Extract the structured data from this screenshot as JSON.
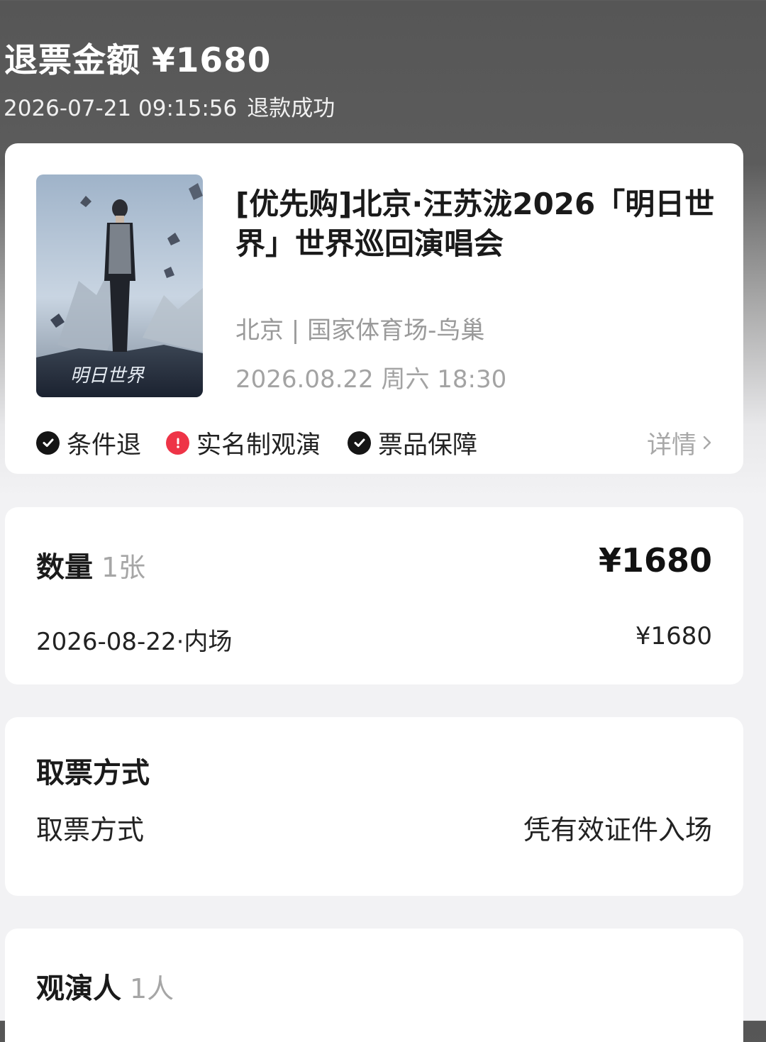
{
  "refund": {
    "label": "退票金额",
    "amount": "¥1680",
    "timestamp": "2026-07-21 09:15:56",
    "status": "退款成功"
  },
  "event": {
    "poster_icon": "concert-poster-image",
    "title": "[优先购]北京·汪苏泷2026「明日世界」世界巡回演唱会",
    "venue": "北京 | 国家体育场-鸟巢",
    "datetime": "2026.08.22 周六 18:30",
    "tags": [
      {
        "label": "条件退",
        "icon": "check-circle-icon",
        "color": "#151515"
      },
      {
        "label": "实名制观演",
        "icon": "alert-circle-icon",
        "color": "#ee3447"
      },
      {
        "label": "票品保障",
        "icon": "check-circle-icon",
        "color": "#151515"
      }
    ],
    "detail_label": "详情"
  },
  "quantity": {
    "label": "数量",
    "count": "1张",
    "total": "¥1680",
    "items": [
      {
        "desc": "2026-08-22·内场",
        "price": "¥1680"
      }
    ]
  },
  "pickup": {
    "section_title": "取票方式",
    "label": "取票方式",
    "value": "凭有效证件入场"
  },
  "viewers": {
    "label": "观演人",
    "count": "1人"
  }
}
